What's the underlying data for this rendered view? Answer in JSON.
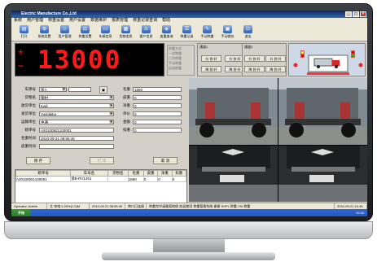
{
  "window": {
    "title": "Electric Manufacture Co.,Ltd"
  },
  "menu": [
    "系统",
    "用户管理",
    "称重设置",
    "用户设置",
    "数据维护",
    "报表管理",
    "称重记录查询",
    "帮助"
  ],
  "toolbar": [
    {
      "label": "打开",
      "icon": "open-icon"
    },
    {
      "label": "系统设置",
      "icon": "settings-icon"
    },
    {
      "label": "用户管理",
      "icon": "users-icon"
    },
    {
      "label": "称重设置",
      "icon": "scale-icon"
    },
    {
      "label": "车辆信息",
      "icon": "truck-icon"
    },
    {
      "label": "货物信息",
      "icon": "cargo-icon"
    },
    {
      "label": "客户信息",
      "icon": "customer-icon"
    },
    {
      "label": "皮重查询",
      "icon": "tare-icon"
    },
    {
      "label": "称重记录",
      "icon": "record-icon"
    },
    {
      "label": "手动称重",
      "icon": "manual-icon"
    },
    {
      "label": "手动保存",
      "icon": "save-icon"
    },
    {
      "label": "退出",
      "icon": "exit-icon"
    }
  ],
  "weight": {
    "sign": "+",
    "value": "13000"
  },
  "options": {
    "title": "称重方式",
    "items": [
      "一次称重",
      "二次称重",
      "手动称重",
      "自动称重"
    ]
  },
  "lanes": [
    {
      "title": "通道1",
      "up": "升 到 杆",
      "down": "降 到 杆"
    },
    {
      "title": "通道2",
      "up": "升 到 杆",
      "down": "降 到 杆"
    }
  ],
  "form": {
    "plate_label": "车牌号",
    "plate_value": "",
    "plate_hint": "浙A",
    "goods_label": "货物名",
    "goods_value": "钢材",
    "receiver_label": "收货单位",
    "receiver_value": "Kaili",
    "sender_label": "发货单位",
    "sender_value": "Yoshikitoi",
    "transport_label": "运输单位",
    "transport_value": "中通",
    "no_label": "磅单号",
    "no_value": "A20100921100001",
    "first_label": "毛重时间",
    "first_value": "2010-09-21 08:55:46",
    "second_label": "皮重时间",
    "second_value": "",
    "gross_label": "毛重",
    "gross_value": "1660",
    "tare_label": "皮重",
    "tare_value": "0",
    "net_label": "净重",
    "net_value": "0",
    "price_label": "单价",
    "price_value": "0",
    "amount_label": "金额",
    "amount_value": "0",
    "deduct_label": "扣重",
    "deduct_value": "0"
  },
  "buttons": {
    "save": "保 存",
    "print": "打 印",
    "cancel": "取 消",
    "exit": "退 出"
  },
  "grid": {
    "headers": [
      "磅单号",
      "车号名",
      "货物名",
      "毛重",
      "皮重",
      "净重",
      "扣重"
    ],
    "rows": [
      [
        "A20100921100001",
        "浙B-RV1451",
        "",
        "1660",
        "0",
        "0",
        "0"
      ]
    ]
  },
  "status": [
    "Operator: Admin",
    "主 充电:1.25%(1.0)M",
    "2010-09-21 08:55:46",
    "串口已连接",
    "称重完毕请驶离地磅 欢迎使用 称重管理系统 谢谢 SHPL 称重 CM 称重",
    "2010-09-21 10:46"
  ],
  "taskbar": {
    "start": "开始",
    "time": "10:46"
  }
}
